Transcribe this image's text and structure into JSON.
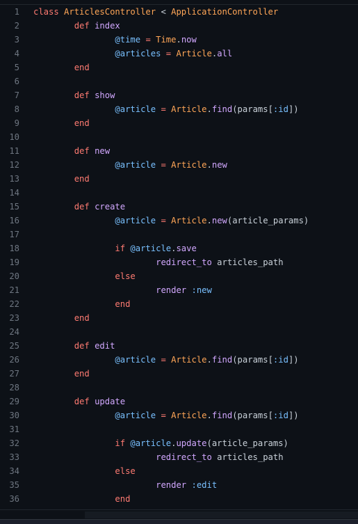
{
  "editor": {
    "language": "ruby",
    "colors": {
      "background": "#0d1117",
      "line_number": "#6e7681",
      "keyword": "#ff7b72",
      "function": "#d2a8ff",
      "class": "#ffa657",
      "instance_variable": "#79c0ff",
      "text": "#c9d1d9"
    },
    "lines": [
      {
        "n": "1",
        "tokens": [
          [
            "kw",
            "class "
          ],
          [
            "cls",
            "ArticlesController"
          ],
          [
            "plain",
            " < "
          ],
          [
            "cls",
            "ApplicationController"
          ]
        ]
      },
      {
        "n": "2",
        "tokens": [
          [
            "plain",
            "        "
          ],
          [
            "kw",
            "def "
          ],
          [
            "fn",
            "index"
          ]
        ]
      },
      {
        "n": "3",
        "tokens": [
          [
            "plain",
            "                "
          ],
          [
            "ivar",
            "@time"
          ],
          [
            "plain",
            " "
          ],
          [
            "op",
            "="
          ],
          [
            "plain",
            " "
          ],
          [
            "cls",
            "Time"
          ],
          [
            "plain",
            "."
          ],
          [
            "meth",
            "now"
          ]
        ]
      },
      {
        "n": "4",
        "tokens": [
          [
            "plain",
            "                "
          ],
          [
            "ivar",
            "@articles"
          ],
          [
            "plain",
            " "
          ],
          [
            "op",
            "="
          ],
          [
            "plain",
            " "
          ],
          [
            "cls",
            "Article"
          ],
          [
            "plain",
            "."
          ],
          [
            "meth",
            "all"
          ]
        ]
      },
      {
        "n": "5",
        "tokens": [
          [
            "plain",
            "        "
          ],
          [
            "kw",
            "end"
          ]
        ]
      },
      {
        "n": "6",
        "tokens": []
      },
      {
        "n": "7",
        "tokens": [
          [
            "plain",
            "        "
          ],
          [
            "kw",
            "def "
          ],
          [
            "fn",
            "show"
          ]
        ]
      },
      {
        "n": "8",
        "tokens": [
          [
            "plain",
            "                "
          ],
          [
            "ivar",
            "@article"
          ],
          [
            "plain",
            " "
          ],
          [
            "op",
            "="
          ],
          [
            "plain",
            " "
          ],
          [
            "cls",
            "Article"
          ],
          [
            "plain",
            "."
          ],
          [
            "meth",
            "find"
          ],
          [
            "plain",
            "(params["
          ],
          [
            "sym",
            ":id"
          ],
          [
            "plain",
            "])"
          ]
        ]
      },
      {
        "n": "9",
        "tokens": [
          [
            "plain",
            "        "
          ],
          [
            "kw",
            "end"
          ]
        ]
      },
      {
        "n": "10",
        "tokens": []
      },
      {
        "n": "11",
        "tokens": [
          [
            "plain",
            "        "
          ],
          [
            "kw",
            "def "
          ],
          [
            "fn",
            "new"
          ]
        ]
      },
      {
        "n": "12",
        "tokens": [
          [
            "plain",
            "                "
          ],
          [
            "ivar",
            "@article"
          ],
          [
            "plain",
            " "
          ],
          [
            "op",
            "="
          ],
          [
            "plain",
            " "
          ],
          [
            "cls",
            "Article"
          ],
          [
            "plain",
            "."
          ],
          [
            "meth",
            "new"
          ]
        ]
      },
      {
        "n": "13",
        "tokens": [
          [
            "plain",
            "        "
          ],
          [
            "kw",
            "end"
          ]
        ]
      },
      {
        "n": "14",
        "tokens": []
      },
      {
        "n": "15",
        "tokens": [
          [
            "plain",
            "        "
          ],
          [
            "kw",
            "def "
          ],
          [
            "fn",
            "create"
          ]
        ]
      },
      {
        "n": "16",
        "tokens": [
          [
            "plain",
            "                "
          ],
          [
            "ivar",
            "@article"
          ],
          [
            "plain",
            " "
          ],
          [
            "op",
            "="
          ],
          [
            "plain",
            " "
          ],
          [
            "cls",
            "Article"
          ],
          [
            "plain",
            "."
          ],
          [
            "meth",
            "new"
          ],
          [
            "plain",
            "(article_params)"
          ]
        ]
      },
      {
        "n": "17",
        "tokens": []
      },
      {
        "n": "18",
        "tokens": [
          [
            "plain",
            "                "
          ],
          [
            "kw",
            "if "
          ],
          [
            "ivar",
            "@article"
          ],
          [
            "plain",
            "."
          ],
          [
            "meth",
            "save"
          ]
        ]
      },
      {
        "n": "19",
        "tokens": [
          [
            "plain",
            "                        "
          ],
          [
            "meth",
            "redirect_to"
          ],
          [
            "plain",
            " articles_path"
          ]
        ]
      },
      {
        "n": "20",
        "tokens": [
          [
            "plain",
            "                "
          ],
          [
            "kw",
            "else"
          ]
        ]
      },
      {
        "n": "21",
        "tokens": [
          [
            "plain",
            "                        "
          ],
          [
            "meth",
            "render"
          ],
          [
            "plain",
            " "
          ],
          [
            "sym",
            ":new"
          ]
        ]
      },
      {
        "n": "22",
        "tokens": [
          [
            "plain",
            "                "
          ],
          [
            "kw",
            "end"
          ]
        ]
      },
      {
        "n": "23",
        "tokens": [
          [
            "plain",
            "        "
          ],
          [
            "kw",
            "end"
          ]
        ]
      },
      {
        "n": "24",
        "tokens": []
      },
      {
        "n": "25",
        "tokens": [
          [
            "plain",
            "        "
          ],
          [
            "kw",
            "def "
          ],
          [
            "fn",
            "edit"
          ]
        ]
      },
      {
        "n": "26",
        "tokens": [
          [
            "plain",
            "                "
          ],
          [
            "ivar",
            "@article"
          ],
          [
            "plain",
            " "
          ],
          [
            "op",
            "="
          ],
          [
            "plain",
            " "
          ],
          [
            "cls",
            "Article"
          ],
          [
            "plain",
            "."
          ],
          [
            "meth",
            "find"
          ],
          [
            "plain",
            "(params["
          ],
          [
            "sym",
            ":id"
          ],
          [
            "plain",
            "])"
          ]
        ]
      },
      {
        "n": "27",
        "tokens": [
          [
            "plain",
            "        "
          ],
          [
            "kw",
            "end"
          ]
        ]
      },
      {
        "n": "28",
        "tokens": []
      },
      {
        "n": "29",
        "tokens": [
          [
            "plain",
            "        "
          ],
          [
            "kw",
            "def "
          ],
          [
            "fn",
            "update"
          ]
        ]
      },
      {
        "n": "30",
        "tokens": [
          [
            "plain",
            "                "
          ],
          [
            "ivar",
            "@article"
          ],
          [
            "plain",
            " "
          ],
          [
            "op",
            "="
          ],
          [
            "plain",
            " "
          ],
          [
            "cls",
            "Article"
          ],
          [
            "plain",
            "."
          ],
          [
            "meth",
            "find"
          ],
          [
            "plain",
            "(params["
          ],
          [
            "sym",
            ":id"
          ],
          [
            "plain",
            "])"
          ]
        ]
      },
      {
        "n": "31",
        "tokens": []
      },
      {
        "n": "32",
        "tokens": [
          [
            "plain",
            "                "
          ],
          [
            "kw",
            "if "
          ],
          [
            "ivar",
            "@article"
          ],
          [
            "plain",
            "."
          ],
          [
            "meth",
            "update"
          ],
          [
            "plain",
            "(article_params)"
          ]
        ]
      },
      {
        "n": "33",
        "tokens": [
          [
            "plain",
            "                        "
          ],
          [
            "meth",
            "redirect_to"
          ],
          [
            "plain",
            " articles_path"
          ]
        ]
      },
      {
        "n": "34",
        "tokens": [
          [
            "plain",
            "                "
          ],
          [
            "kw",
            "else"
          ]
        ]
      },
      {
        "n": "35",
        "tokens": [
          [
            "plain",
            "                        "
          ],
          [
            "meth",
            "render"
          ],
          [
            "plain",
            " "
          ],
          [
            "sym",
            ":edit"
          ]
        ]
      },
      {
        "n": "36",
        "tokens": [
          [
            "plain",
            "                "
          ],
          [
            "kw",
            "end"
          ]
        ]
      }
    ]
  }
}
